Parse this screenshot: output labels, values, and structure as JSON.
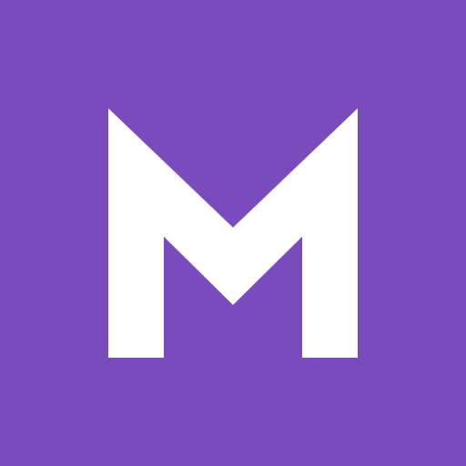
{
  "icon": {
    "name": "M",
    "letter": "M",
    "background_color": "#7a4bbd",
    "glyph_color": "#ffffff"
  }
}
